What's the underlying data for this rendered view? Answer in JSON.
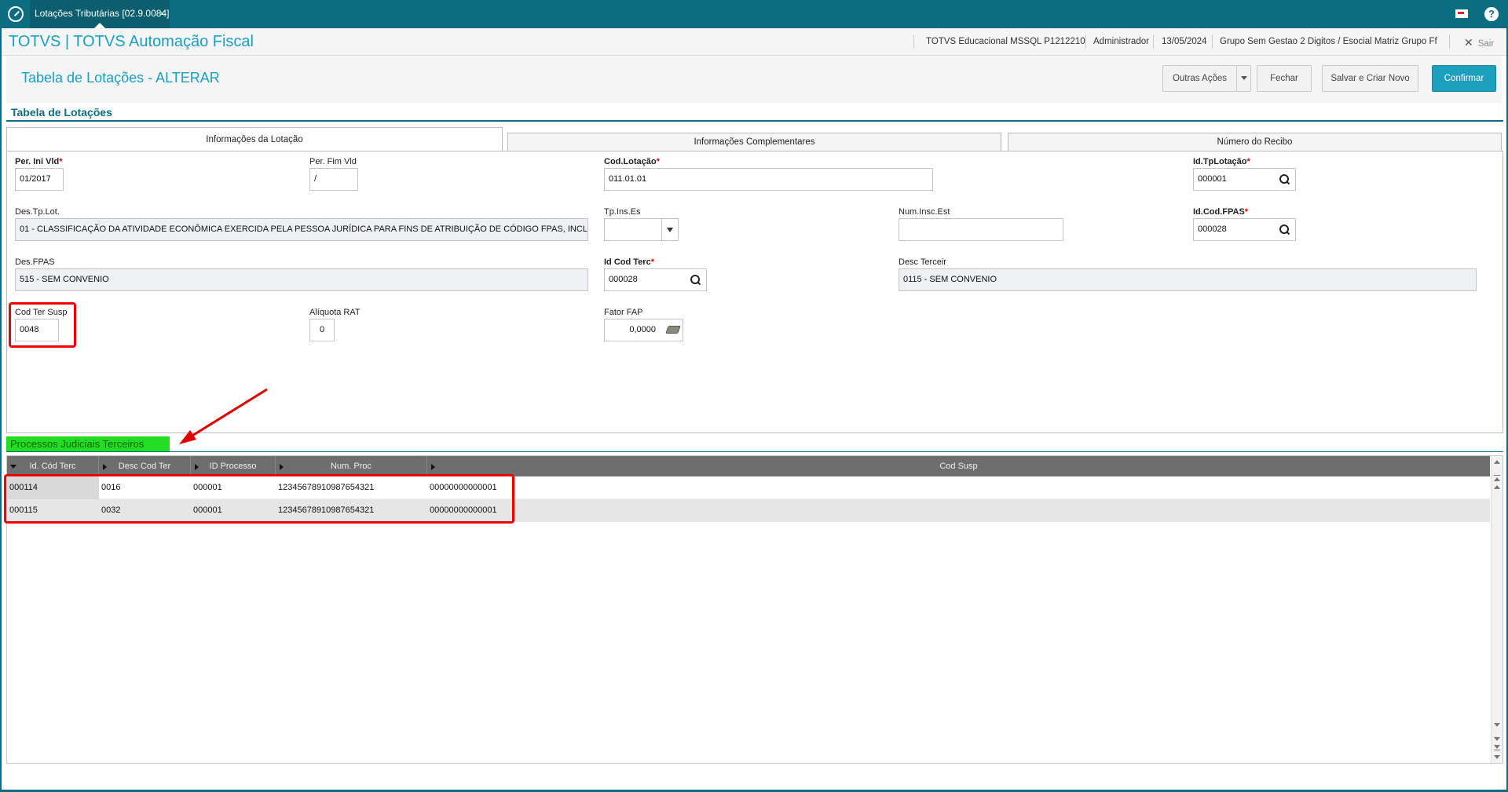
{
  "topbar": {
    "tab_title": "Lotações Tributárias [02.9.0084]",
    "tab_close": "×",
    "help": "?"
  },
  "header": {
    "app_title": "TOTVS | TOTVS Automação Fiscal",
    "environment": "TOTVS Educacional MSSQL P1212210",
    "user": "Administrador",
    "date": "13/05/2024",
    "company": "Grupo Sem Gestao 2 Digitos / Esocial Matriz Grupo Ff",
    "exit_label": "Sair",
    "exit_icon": "✕"
  },
  "page": {
    "title": "Tabela de Lotações - ALTERAR",
    "buttons": {
      "outras_acoes": "Outras Ações",
      "fechar": "Fechar",
      "salvar_criar": "Salvar e Criar Novo",
      "confirmar": "Confirmar"
    }
  },
  "section": {
    "title": "Tabela de Lotações"
  },
  "tabs": [
    {
      "label": "Informações da Lotação",
      "active": true
    },
    {
      "label": "Informações Complementares",
      "active": false
    },
    {
      "label": "Número do Recibo",
      "active": false
    }
  ],
  "form": {
    "per_ini_vld": {
      "label": "Per. Ini Vld",
      "required": "*",
      "value": "01/2017"
    },
    "per_fim_vld": {
      "label": "Per. Fim Vld",
      "value": "/"
    },
    "cod_lotacao": {
      "label": "Cod.Lotação",
      "required": "*",
      "value": "011.01.01"
    },
    "id_tp_lotacao": {
      "label": "Id.TpLotação",
      "required": "*",
      "value": "000001"
    },
    "des_tp_lot": {
      "label": "Des.Tp.Lot.",
      "value": "01 - CLASSIFICAÇÃO DA ATIVIDADE ECONÔMICA EXERCIDA PELA PESSOA JURÍDICA PARA FINS DE ATRIBUIÇÃO DE CÓDIGO FPAS, INCL"
    },
    "tp_ins_es": {
      "label": "Tp.Ins.Es",
      "value": ""
    },
    "num_insc_est": {
      "label": "Num.Insc.Est",
      "value": ""
    },
    "id_cod_fpas": {
      "label": "Id.Cod.FPAS",
      "required": "*",
      "value": "000028"
    },
    "des_fpas": {
      "label": "Des.FPAS",
      "value": "515  - SEM CONVENIO"
    },
    "id_cod_terc": {
      "label": "Id Cod Terc",
      "required": "*",
      "value": "000028"
    },
    "desc_terceir": {
      "label": "Desc Terceir",
      "value": "0115 - SEM CONVENIO"
    },
    "cod_ter_susp": {
      "label": "Cod Ter Susp",
      "value": "0048"
    },
    "aliquota_rat": {
      "label": "Alíquota RAT",
      "value": "0"
    },
    "fator_fap": {
      "label": "Fator FAP",
      "value": "0,0000"
    }
  },
  "processos": {
    "title": "Processos Judiciais Terceiros",
    "columns": [
      "Id. Cód Terc",
      "Desc Cod Ter",
      "ID Processo",
      "Num. Proc",
      "Cod Susp"
    ],
    "rows": [
      [
        "000114",
        "0016",
        "000001",
        "12345678910987654321",
        "00000000000001"
      ],
      [
        "000115",
        "0032",
        "000001",
        "12345678910987654321",
        "00000000000001"
      ]
    ]
  },
  "colors": {
    "brand": "#0c6d80",
    "accent": "#1a9fbe",
    "highlight_green": "#22dd22",
    "annotation_red": "#e00000"
  }
}
